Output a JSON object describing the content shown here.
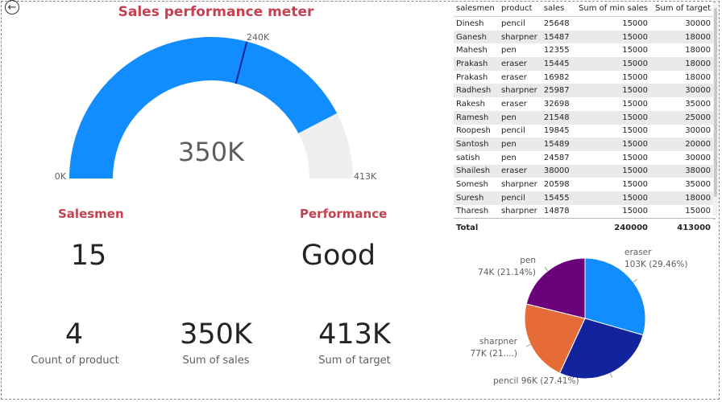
{
  "back_label": "←",
  "gauge": {
    "title": "Sales performance meter",
    "value": 350000,
    "max": 413000,
    "target": 240000,
    "value_label": "350K",
    "min_label": "0K",
    "max_label": "413K",
    "target_label": "240K",
    "fill_color": "#118DFF",
    "track_color": "#F0EFEF",
    "target_color": "#12239E"
  },
  "cards": {
    "salesmen_label": "Salesmen",
    "salesmen_value": "15",
    "performance_label": "Performance",
    "performance_value": "Good",
    "count_product_value": "4",
    "count_product_label": "Count of product",
    "sum_sales_value": "350K",
    "sum_sales_label": "Sum of sales",
    "sum_target_value": "413K",
    "sum_target_label": "Sum of target"
  },
  "table": {
    "columns": [
      "salesmen",
      "product",
      "sales",
      "Sum of min sales",
      "Sum of target"
    ],
    "rows": [
      [
        "Dinesh",
        "pencil",
        "25648",
        "15000",
        "30000"
      ],
      [
        "Ganesh",
        "sharpner",
        "15487",
        "15000",
        "18000"
      ],
      [
        "Mahesh",
        "pen",
        "12355",
        "15000",
        "18000"
      ],
      [
        "Prakash",
        "eraser",
        "15445",
        "15000",
        "18000"
      ],
      [
        "Prakash",
        "eraser",
        "16982",
        "15000",
        "18000"
      ],
      [
        "Radhesh",
        "sharpner",
        "25987",
        "15000",
        "30000"
      ],
      [
        "Rakesh",
        "eraser",
        "32698",
        "15000",
        "35000"
      ],
      [
        "Ramesh",
        "pen",
        "21548",
        "15000",
        "25000"
      ],
      [
        "Roopesh",
        "pencil",
        "19845",
        "15000",
        "30000"
      ],
      [
        "Santosh",
        "pen",
        "15489",
        "15000",
        "20000"
      ],
      [
        "satish",
        "pen",
        "24587",
        "15000",
        "30000"
      ],
      [
        "Shailesh",
        "eraser",
        "38000",
        "15000",
        "38000"
      ],
      [
        "Somesh",
        "sharpner",
        "20598",
        "15000",
        "35000"
      ],
      [
        "Suresh",
        "pencil",
        "15455",
        "15000",
        "18000"
      ],
      [
        "Tharesh",
        "sharpner",
        "14878",
        "15000",
        "15000"
      ]
    ],
    "total": [
      "Total",
      "",
      "",
      "240000",
      "413000"
    ]
  },
  "chart_data": {
    "type": "pie",
    "slices": [
      {
        "name": "eraser",
        "value": 103,
        "percent": 29.46,
        "label": "103K (29.46%)",
        "color": "#118DFF"
      },
      {
        "name": "pencil",
        "value": 96,
        "percent": 27.41,
        "label": "96K (27.41%)",
        "color": "#12239E"
      },
      {
        "name": "sharpner",
        "value": 77,
        "percent": 21.99,
        "label": "77K (21....)",
        "color": "#E66C37"
      },
      {
        "name": "pen",
        "value": 74,
        "percent": 21.14,
        "label": "74K (21.14%)",
        "color": "#6B007B"
      }
    ]
  }
}
